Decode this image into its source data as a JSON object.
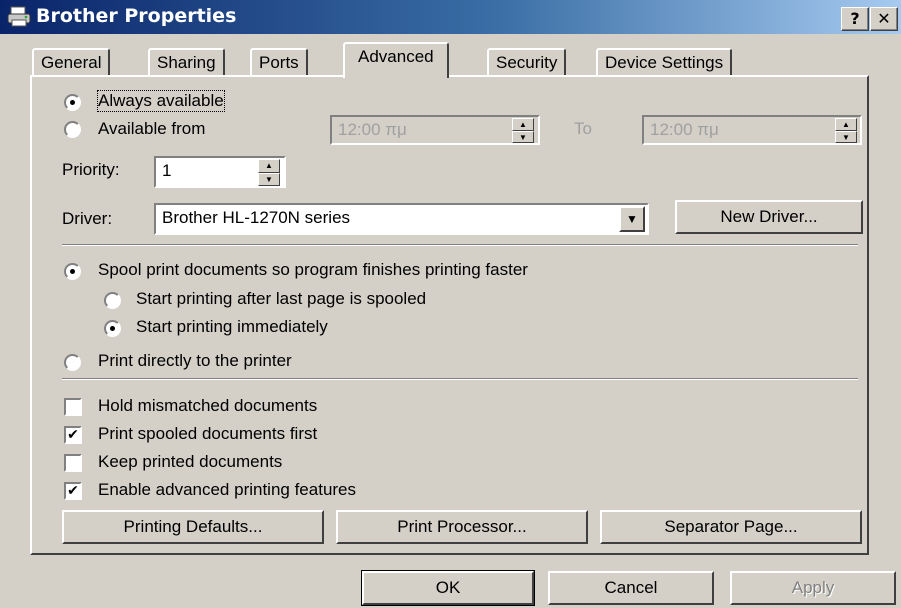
{
  "window": {
    "title": "Brother Properties",
    "help_button": "?",
    "close_button": "✕"
  },
  "tabs": [
    {
      "label": "General"
    },
    {
      "label": "Sharing"
    },
    {
      "label": "Ports"
    },
    {
      "label": "Advanced",
      "active": true
    },
    {
      "label": "Security"
    },
    {
      "label": "Device Settings"
    }
  ],
  "availability": {
    "always_label": "Always available",
    "from_label": "Available from",
    "from_time": "12:00 πμ",
    "to_label": "To",
    "to_time": "12:00 πμ",
    "selected": "always"
  },
  "priority": {
    "label": "Priority:",
    "value": "1"
  },
  "driver": {
    "label": "Driver:",
    "value": "Brother HL-1270N series",
    "new_driver_button": "New Driver..."
  },
  "spooling": {
    "spool_label": "Spool print documents so program finishes printing faster",
    "after_last_page_label": "Start printing after last page is spooled",
    "immediately_label": "Start printing immediately",
    "direct_label": "Print directly to the printer"
  },
  "options": [
    {
      "label": "Hold mismatched documents",
      "checked": false
    },
    {
      "label": "Print spooled documents first",
      "checked": true
    },
    {
      "label": "Keep printed documents",
      "checked": false
    },
    {
      "label": "Enable advanced printing features",
      "checked": true
    }
  ],
  "panel_buttons": {
    "printing_defaults": "Printing Defaults...",
    "print_processor": "Print Processor...",
    "separator_page": "Separator Page..."
  },
  "dialog_buttons": {
    "ok": "OK",
    "cancel": "Cancel",
    "apply": "Apply"
  },
  "colors": {
    "titlebar_start": "#0a246a",
    "titlebar_end": "#a6caf0",
    "face": "#d4d0c8"
  }
}
